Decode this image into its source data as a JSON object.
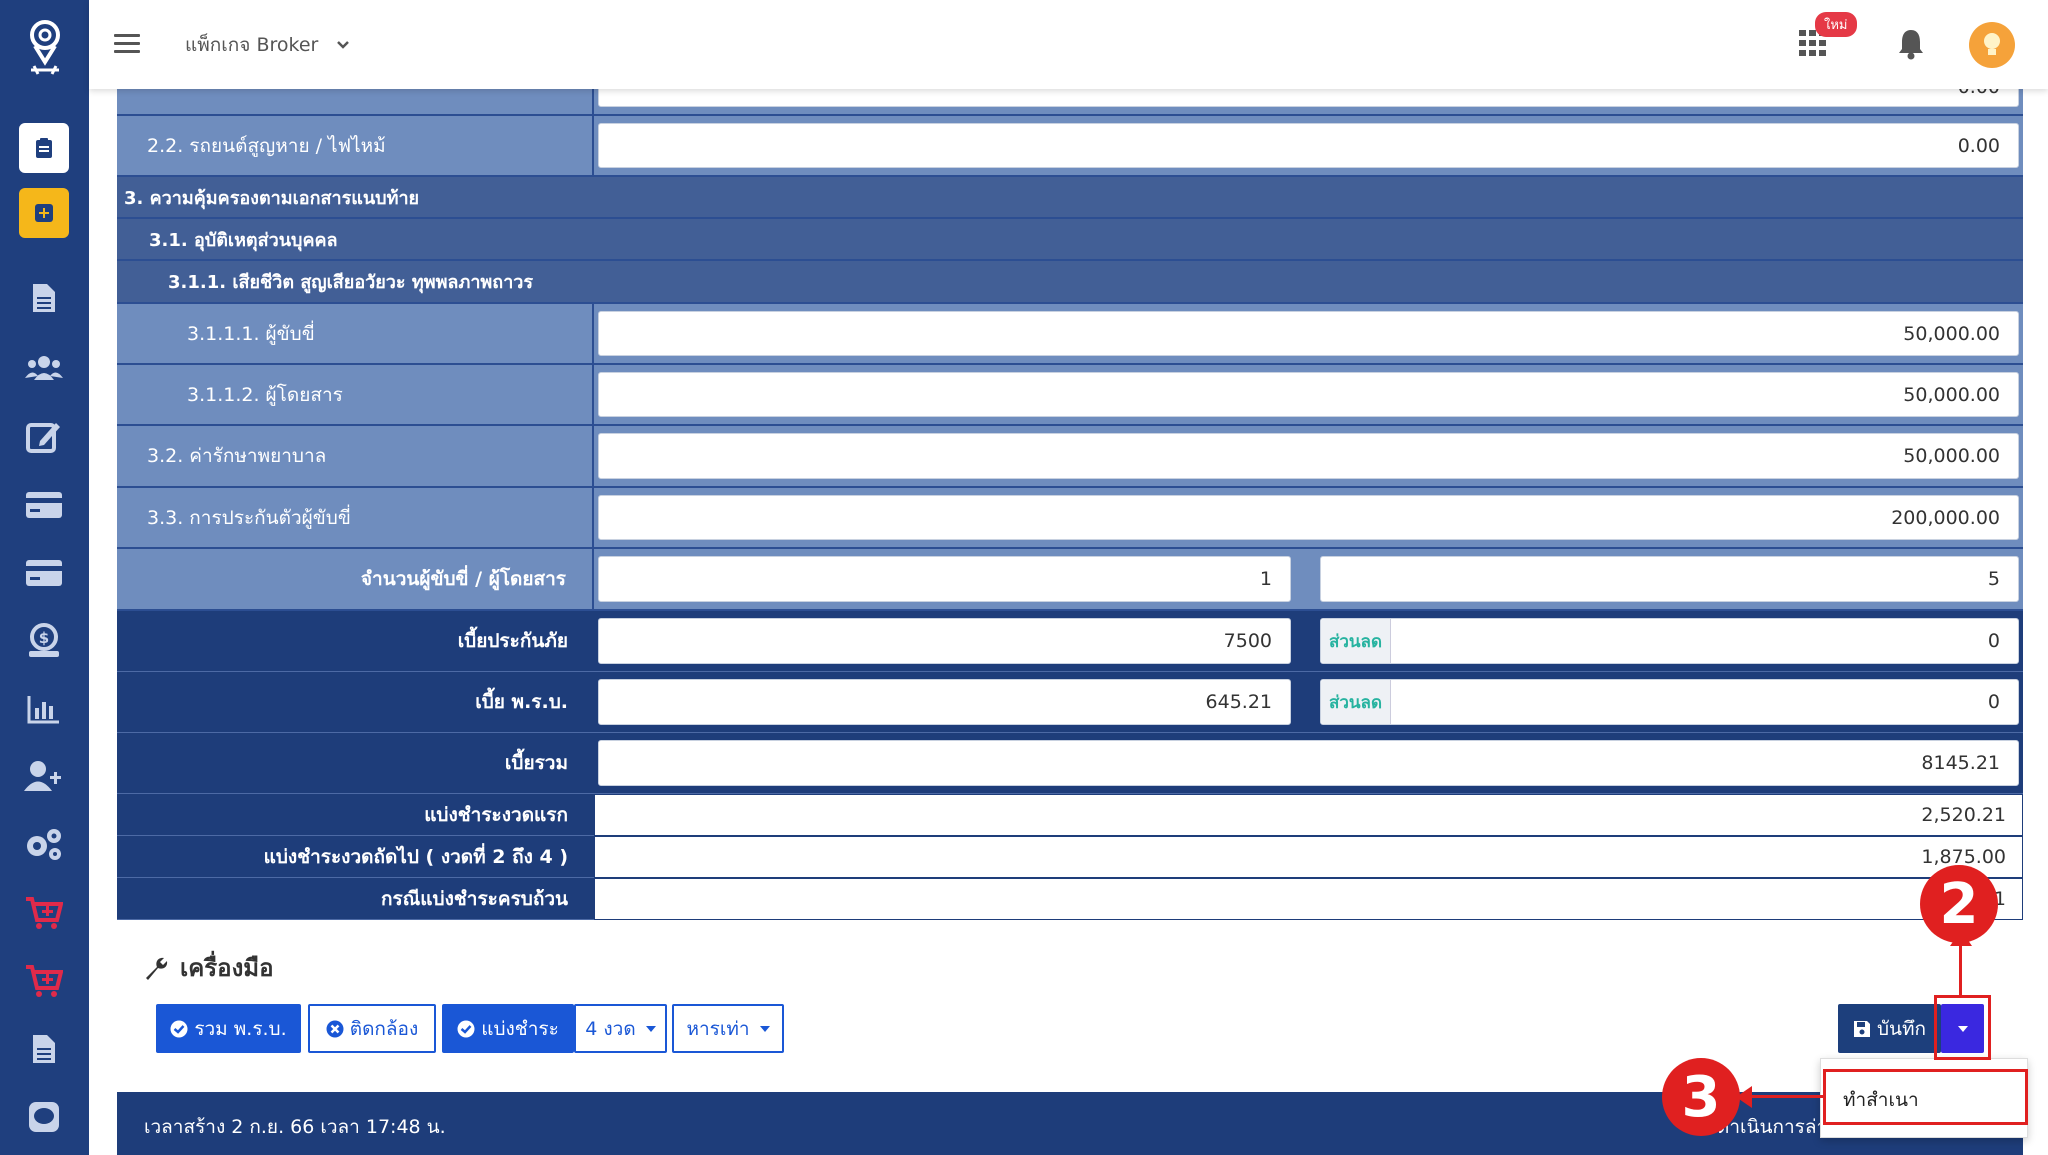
{
  "topbar": {
    "package_label": "แพ็กเกจ Broker",
    "new_badge": "ใหม่"
  },
  "rows": {
    "partial_top_value": "0.00",
    "r22_label": "2.2. รถยนต์สูญหาย / ไฟไหม้",
    "r22_value": "0.00",
    "sec3": "3. ความคุ้มครองตามเอกสารแนบท้าย",
    "sec31": "3.1. อุบัติเหตุส่วนบุคคล",
    "sec311": "3.1.1. เสียชีวิต สูญเสียอวัยวะ ทุพพลภาพถาวร",
    "r3111_label": "3.1.1.1. ผู้ขับขี่",
    "r3111_value": "50,000.00",
    "r3112_label": "3.1.1.2. ผู้โดยสาร",
    "r3112_value": "50,000.00",
    "r32_label": "3.2. ค่ารักษาพยาบาล",
    "r32_value": "50,000.00",
    "r33_label": "3.3. การประกันตัวผู้ขับขี่",
    "r33_value": "200,000.00",
    "count_label": "จำนวนผู้ขับขี่ / ผู้โดยสาร",
    "count_driver": "1",
    "count_passenger": "5",
    "premium_label": "เบี้ยประกันภัย",
    "premium_value": "7500",
    "discount_label": "ส่วนลด",
    "premium_discount": "0",
    "compulsory_label": "เบี้ย พ.ร.บ.",
    "compulsory_value": "645.21",
    "compulsory_discount": "0",
    "total_label": "เบี้ยรวม",
    "total_value": "8145.21",
    "first_installment_label": "แบ่งชำระงวดแรก",
    "first_installment_value": "2,520.21",
    "next_installment_label": "แบ่งชำระงวดถัดไป ( งวดที่ 2 ถึง 4 )",
    "next_installment_value": "1,875.00",
    "full_payment_label": "กรณีแบ่งชำระครบถ้วน",
    "full_payment_value": "8,1"
  },
  "tools": {
    "title": "เครื่องมือ",
    "include_compulsory": "รวม พ.ร.บ.",
    "stick": "ติดกล้อง",
    "installment": "แบ่งชำระ",
    "installment_count": "4 งวด",
    "divide": "หารเท่า",
    "save": "บันทึก",
    "dropdown_copy": "ทำสำเนา"
  },
  "footer": {
    "created": "เวลาสร้าง 2 ก.ย. 66 เวลา 17:48 น.",
    "action": "ดำเนินการล่า"
  },
  "annotations": {
    "marker2": "2",
    "marker3": "3"
  }
}
